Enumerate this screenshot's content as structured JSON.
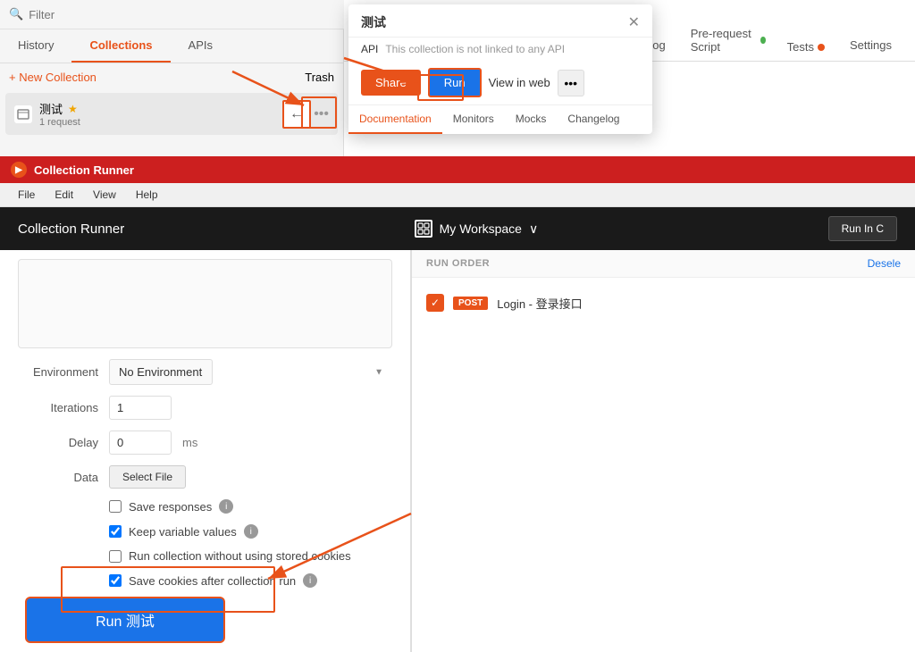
{
  "filter": {
    "placeholder": "Filter"
  },
  "sidebar": {
    "tabs": [
      {
        "label": "History",
        "active": false
      },
      {
        "label": "Collections",
        "active": true
      },
      {
        "label": "APIs",
        "active": false
      }
    ],
    "new_collection_label": "+ New Collection",
    "trash_label": "Trash",
    "items": [
      {
        "name": "测试",
        "star": "★",
        "sub": "1 request"
      }
    ]
  },
  "back_arrow": "←",
  "tabs": [
    {
      "label": "Documentation",
      "active": false
    },
    {
      "label": "Monitors",
      "active": false
    },
    {
      "label": "Mocks",
      "active": false
    },
    {
      "label": "Changelog",
      "active": false
    },
    {
      "label": "Pre-request Script",
      "active": false
    },
    {
      "label": "Tests",
      "active": false
    },
    {
      "label": "Settings",
      "active": false
    }
  ],
  "modal": {
    "title": "测试",
    "api_label": "API",
    "api_desc": "This collection is not linked to any API",
    "share_label": "Share",
    "run_label": "Run",
    "view_web_label": "View in web",
    "dots": "•••",
    "tabs": [
      {
        "label": "Documentation",
        "active": true
      },
      {
        "label": "Monitors",
        "active": false
      },
      {
        "label": "Mocks",
        "active": false
      },
      {
        "label": "Changelog",
        "active": false
      }
    ]
  },
  "runner": {
    "titlebar": "Collection Runner",
    "menu": [
      "File",
      "Edit",
      "View",
      "Help"
    ],
    "header_title": "Collection Runner",
    "workspace_label": "My Workspace",
    "run_in_cloud": "Run In C",
    "environment": {
      "label": "Environment",
      "value": "No Environment"
    },
    "iterations": {
      "label": "Iterations",
      "value": "1"
    },
    "delay": {
      "label": "Delay",
      "value": "0",
      "unit": "ms"
    },
    "data": {
      "label": "Data",
      "btn": "Select File"
    },
    "checkboxes": [
      {
        "label": "Save responses",
        "checked": false,
        "info": true
      },
      {
        "label": "Keep variable values",
        "checked": true,
        "info": true
      },
      {
        "label": "Run collection without using stored cookies",
        "checked": false,
        "info": false
      },
      {
        "label": "Save cookies after collection run",
        "checked": true,
        "info": true
      }
    ],
    "run_btn_label": "Run 测试",
    "run_order_label": "RUN ORDER",
    "deselect_label": "Desele",
    "requests": [
      {
        "method": "POST",
        "name": "Login - 登录接口",
        "checked": true
      }
    ]
  }
}
